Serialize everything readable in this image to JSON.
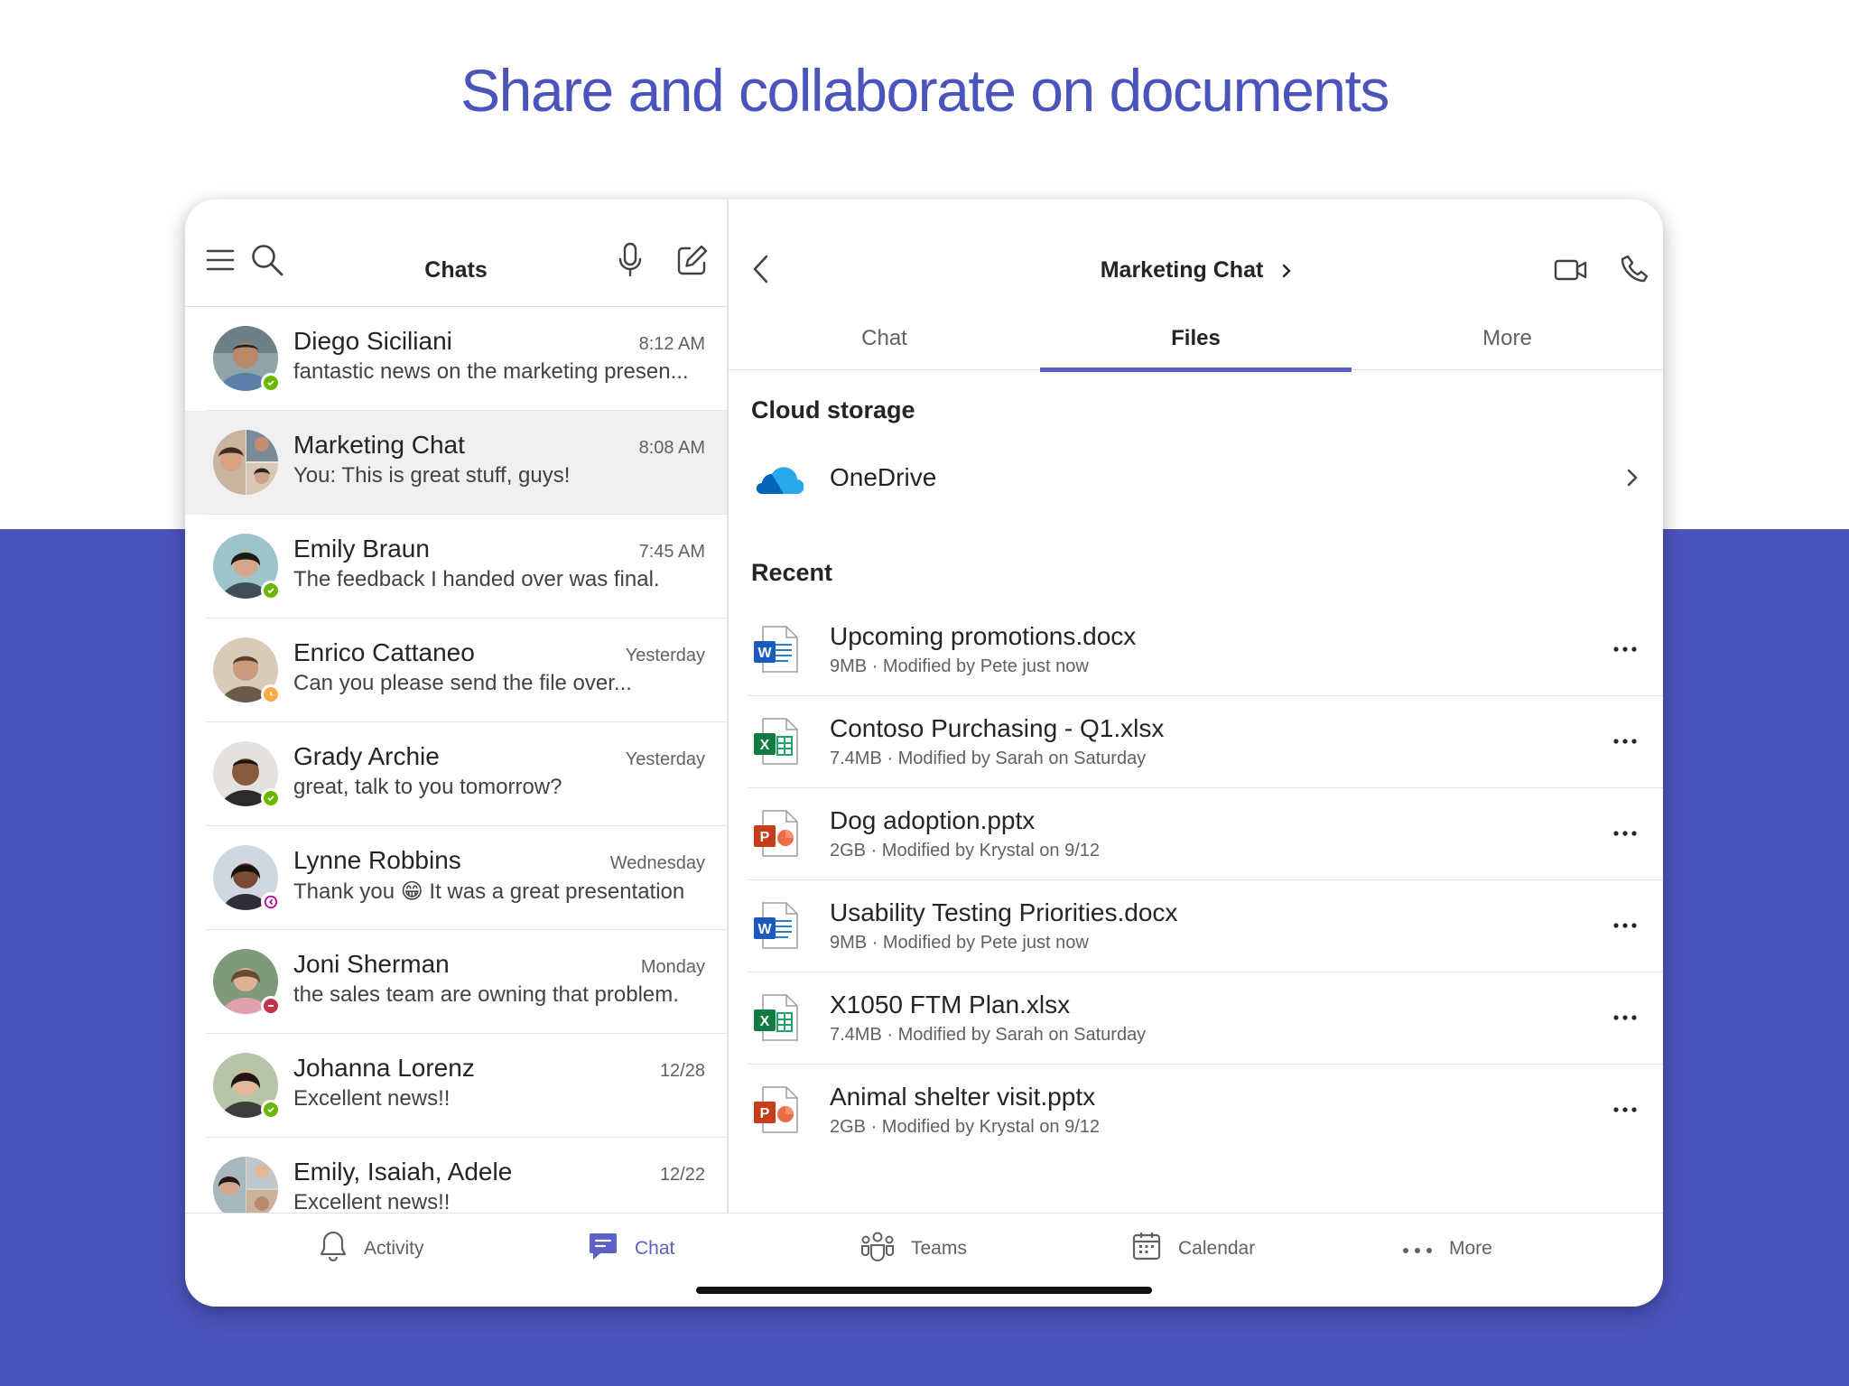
{
  "headline": "Share and collaborate on documents",
  "colors": {
    "brand": "#4b53bc",
    "accent": "#5b5fc7",
    "available": "#6bb700",
    "away": "#ffaa44",
    "dnd": "#c4314b",
    "oof": "#b4009e"
  },
  "left_header": {
    "title": "Chats",
    "icons": [
      "hamburger-menu-icon",
      "search-icon",
      "microphone-icon",
      "compose-icon"
    ]
  },
  "chats": [
    {
      "name": "Diego Siciliani",
      "time": "8:12 AM",
      "preview": "fantastic news on the marketing presen...",
      "presence": "available",
      "selected": false
    },
    {
      "name": "Marketing Chat",
      "time": "8:08 AM",
      "preview": "You: This is great stuff, guys!",
      "presence": "none",
      "selected": true
    },
    {
      "name": "Emily Braun",
      "time": "7:45 AM",
      "preview": "The feedback I handed over was final.",
      "presence": "available",
      "selected": false
    },
    {
      "name": "Enrico Cattaneo",
      "time": "Yesterday",
      "preview": "Can you please send the file over...",
      "presence": "away",
      "selected": false
    },
    {
      "name": "Grady Archie",
      "time": "Yesterday",
      "preview": "great, talk to you tomorrow?",
      "presence": "available",
      "selected": false
    },
    {
      "name": "Lynne Robbins",
      "time": "Wednesday",
      "preview": "Thank you 😁 It was a great presentation",
      "presence": "out-of-office",
      "selected": false
    },
    {
      "name": "Joni Sherman",
      "time": "Monday",
      "preview": "the sales team are owning that problem.",
      "presence": "do-not-disturb",
      "selected": false
    },
    {
      "name": "Johanna Lorenz",
      "time": "12/28",
      "preview": "Excellent news!!",
      "presence": "available",
      "selected": false
    },
    {
      "name": "Emily, Isaiah, Adele",
      "time": "12/22",
      "preview": "Excellent news!!",
      "presence": "none",
      "selected": false
    }
  ],
  "conversation": {
    "title": "Marketing Chat",
    "tabs": [
      {
        "label": "Chat",
        "active": false
      },
      {
        "label": "Files",
        "active": true
      },
      {
        "label": "More",
        "active": false
      }
    ],
    "cloud_storage": {
      "heading": "Cloud storage",
      "provider": "OneDrive"
    },
    "recent": {
      "heading": "Recent",
      "files": [
        {
          "name": "Upcoming promotions.docx",
          "meta": "9MB · Modified by Pete just now",
          "type": "word"
        },
        {
          "name": "Contoso Purchasing - Q1.xlsx",
          "meta": "7.4MB · Modified by Sarah on Saturday",
          "type": "excel"
        },
        {
          "name": "Dog adoption.pptx",
          "meta": "2GB · Modified by Krystal on 9/12",
          "type": "powerpoint"
        },
        {
          "name": "Usability Testing Priorities.docx",
          "meta": "9MB · Modified by Pete just now",
          "type": "word"
        },
        {
          "name": "X1050 FTM Plan.xlsx",
          "meta": "7.4MB · Modified by Sarah on Saturday",
          "type": "excel"
        },
        {
          "name": "Animal shelter visit.pptx",
          "meta": "2GB · Modified by Krystal on 9/12",
          "type": "powerpoint"
        }
      ]
    }
  },
  "bottom_nav": [
    {
      "label": "Activity",
      "icon": "bell-icon",
      "active": false
    },
    {
      "label": "Chat",
      "icon": "chat-icon",
      "active": true
    },
    {
      "label": "Teams",
      "icon": "teams-icon",
      "active": false
    },
    {
      "label": "Calendar",
      "icon": "calendar-icon",
      "active": false
    },
    {
      "label": "More",
      "icon": "more-horizontal-icon",
      "active": false
    }
  ]
}
